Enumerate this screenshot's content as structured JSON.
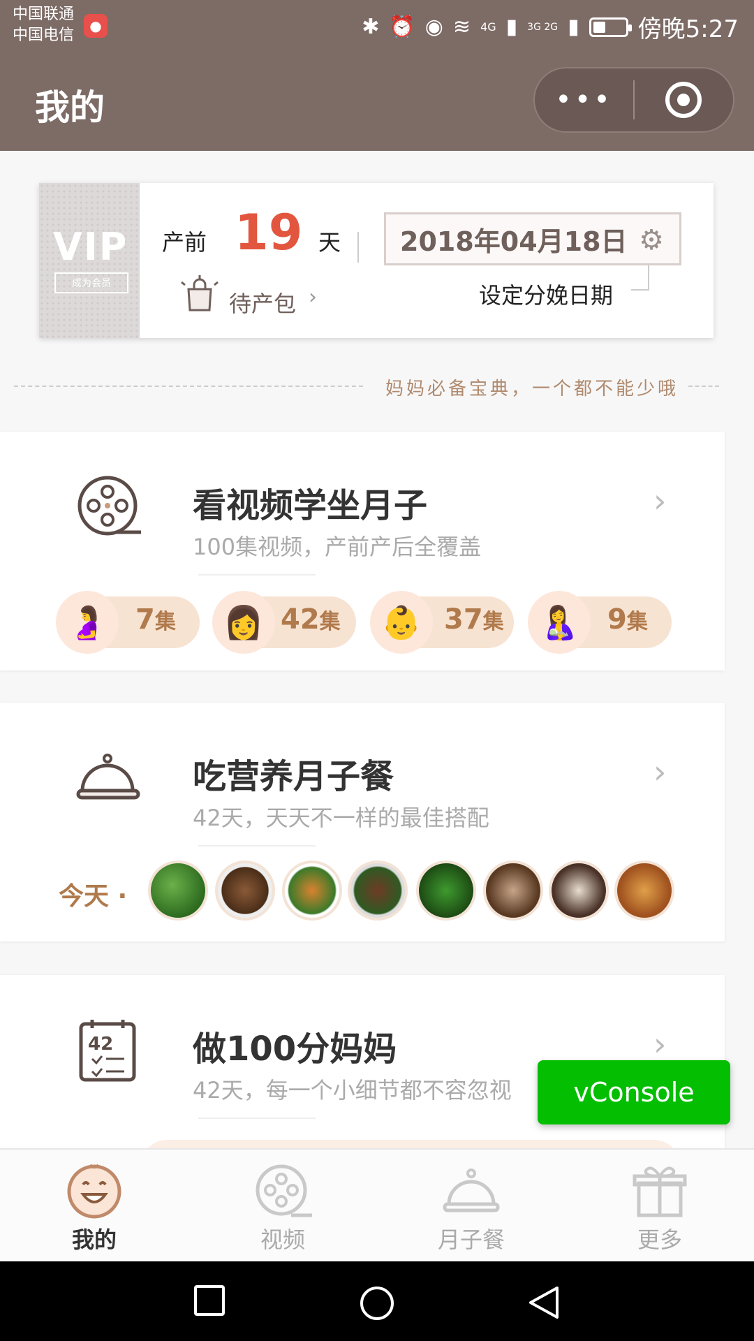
{
  "status_bar": {
    "carrier1": "中国联通",
    "carrier2": "中国电信",
    "network": "4G",
    "network2": "3G 2G",
    "battery_level": 0.4,
    "time": "傍晚5:27"
  },
  "nav": {
    "title": "我的"
  },
  "due_card": {
    "vip_text": "VIP",
    "vip_sub": "成为会员",
    "pre_label": "产前",
    "days": "19",
    "unit": "天",
    "date": "2018年04月18日",
    "date_hint": "设定分娩日期",
    "bag_label": "待产包"
  },
  "divider_text": "妈妈必备宝典，一个都不能少哦",
  "sections": {
    "video": {
      "title": "看视频学坐月子",
      "subtitle": "100集视频，产前产后全覆盖",
      "pills": [
        {
          "num": "7",
          "unit": "集"
        },
        {
          "num": "42",
          "unit": "集"
        },
        {
          "num": "37",
          "unit": "集"
        },
        {
          "num": "9",
          "unit": "集"
        }
      ]
    },
    "meal": {
      "title": "吃营养月子餐",
      "subtitle": "42天，天天不一样的最佳搭配",
      "today_label": "今天 ·"
    },
    "mom": {
      "title": "做100分妈妈",
      "subtitle": "42天，每一个小细节都不容忽视",
      "calendar_num": "42"
    }
  },
  "vconsole_label": "vConsole",
  "tabs": [
    {
      "label": "我的",
      "icon": "smile-face-icon",
      "active": true
    },
    {
      "label": "视频",
      "icon": "film-reel-icon",
      "active": false
    },
    {
      "label": "月子餐",
      "icon": "food-cloche-icon",
      "active": false
    },
    {
      "label": "更多",
      "icon": "gift-icon",
      "active": false
    }
  ],
  "colors": {
    "header_bg": "#7d6b66",
    "accent_red": "#e2563f",
    "accent_brown": "#b07a4c",
    "vconsole_green": "#04be02"
  }
}
